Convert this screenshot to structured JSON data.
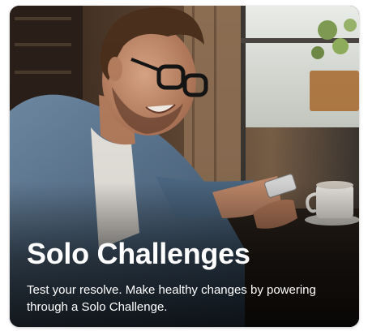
{
  "card": {
    "image": "man-with-glasses-laughing-at-phone-photo",
    "title": "Solo Challenges",
    "description": "Test your resolve. Make healthy changes by powering through a Solo Challenge."
  },
  "colors": {
    "text": "#ffffff",
    "page_background": "#ffffff"
  }
}
